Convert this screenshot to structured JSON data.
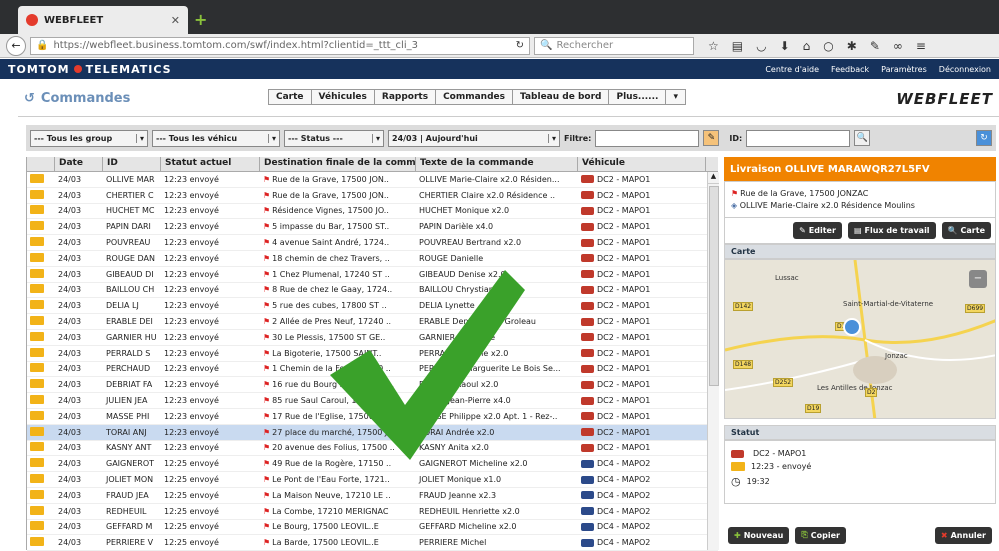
{
  "browser": {
    "tab_title": "WEBFLEET",
    "url": "https://webfleet.business.tomtom.com/swf/index.html?clientid=_ttt_cli_3",
    "search_placeholder": "Rechercher"
  },
  "brand": {
    "name": "TOMTOM",
    "suffix": "TELEMATICS",
    "links": [
      "Centre d'aide",
      "Feedback",
      "Paramètres",
      "Déconnexion"
    ]
  },
  "app": {
    "page_title": "Commandes",
    "menu": [
      "Carte",
      "Véhicules",
      "Rapports",
      "Commandes",
      "Tableau de bord",
      "Plus......"
    ],
    "logo": "WEBFLEET"
  },
  "filters": {
    "groups": "--- Tous les group",
    "vehicles": "--- Tous les véhicu",
    "status": "--- Status ---",
    "date": "24/03 | Aujourd'hui",
    "filter_label": "Filtre:",
    "id_label": "ID:"
  },
  "columns": [
    "Date",
    "ID",
    "Statut actuel",
    "Destination finale de la comm",
    "Texte de la commande",
    "Véhicule"
  ],
  "rows": [
    {
      "date": "24/03",
      "id": "OLLIVE MAR",
      "status": "12:23 envoyé",
      "dest": "Rue de la Grave, 17500 JON..",
      "text": "OLLIVE Marie-Claire x2.0 Résiden...",
      "veh": "DC2 - MAPO1",
      "truck": "red"
    },
    {
      "date": "24/03",
      "id": "CHERTIER C",
      "status": "12:23 envoyé",
      "dest": "Rue de la Grave, 17500 JON..",
      "text": "CHERTIER Claire x2.0 Résidence ..",
      "veh": "DC2 - MAPO1",
      "truck": "red"
    },
    {
      "date": "24/03",
      "id": "HUCHET MC",
      "status": "12:23 envoyé",
      "dest": "Résidence Vignes, 17500 JO..",
      "text": "HUCHET Monique x2.0",
      "veh": "DC2 - MAPO1",
      "truck": "red"
    },
    {
      "date": "24/03",
      "id": "PAPIN DARI",
      "status": "12:23 envoyé",
      "dest": "5 impasse du Bar, 17500 ST..",
      "text": "PAPIN Darièle x4.0",
      "veh": "DC2 - MAPO1",
      "truck": "red"
    },
    {
      "date": "24/03",
      "id": "POUVREAU",
      "status": "12:23 envoyé",
      "dest": "4 avenue Saint André, 1724..",
      "text": "POUVREAU Bertrand x2.0",
      "veh": "DC2 - MAPO1",
      "truck": "red"
    },
    {
      "date": "24/03",
      "id": "ROUGE DAN",
      "status": "12:23 envoyé",
      "dest": "18 chemin de chez Travers, ..",
      "text": "ROUGE Danielle",
      "veh": "DC2 - MAPO1",
      "truck": "red"
    },
    {
      "date": "24/03",
      "id": "GIBEAUD DI",
      "status": "12:23 envoyé",
      "dest": "1 Chez Plumenal, 17240 ST ..",
      "text": "GIBEAUD Denise x2.0",
      "veh": "DC2 - MAPO1",
      "truck": "red"
    },
    {
      "date": "24/03",
      "id": "BAILLOU CH",
      "status": "12:23 envoyé",
      "dest": "8 Rue de chez le Gaay, 1724..",
      "text": "BAILLOU Chrystiane x2.0",
      "veh": "DC2 - MAPO1",
      "truck": "red"
    },
    {
      "date": "24/03",
      "id": "DELIA  LJ",
      "status": "12:23 envoyé",
      "dest": "5 rue des cubes, 17800 ST ..",
      "text": "DELIA  Lynette",
      "veh": "DC2 - MAPO1",
      "truck": "red"
    },
    {
      "date": "24/03",
      "id": "ERABLE DEI",
      "status": "12:23 envoyé",
      "dest": "2 Allée de Pres Neuf, 17240 ..",
      "text": "ERABLE Denise Chez Groleau",
      "veh": "DC2 - MAPO1",
      "truck": "red"
    },
    {
      "date": "24/03",
      "id": "GARNIER HU",
      "status": "12:23 envoyé",
      "dest": "30 Le Plessis, 17500 ST GE..",
      "text": "GARNIER Huguette",
      "veh": "DC2 - MAPO1",
      "truck": "red"
    },
    {
      "date": "24/03",
      "id": "PERRALD  S",
      "status": "12:23 envoyé",
      "dest": "La Bigoterie, 17500 SAINT..",
      "text": "PERRALD Simone x2.0",
      "veh": "DC2 - MAPO1",
      "truck": "red"
    },
    {
      "date": "24/03",
      "id": "PERCHAUD",
      "status": "12:23 envoyé",
      "dest": "1 Chemin de la Font, 17500 ..",
      "text": "PERCHAUD Marguerite Le Bois Se...",
      "veh": "DC2 - MAPO1",
      "truck": "red"
    },
    {
      "date": "24/03",
      "id": "DEBRIAT FA",
      "status": "12:23 envoyé",
      "dest": "16 rue du Bourg Neuf, 17500..",
      "text": "DEBRIAT Raoul x2.0",
      "veh": "DC2 - MAPO1",
      "truck": "red"
    },
    {
      "date": "24/03",
      "id": "JULIEN JEA",
      "status": "12:23 envoyé",
      "dest": "85 rue Saul Caroul, 17500 J..",
      "text": "JULIEN Jean-Pierre x4.0",
      "veh": "DC2 - MAPO1",
      "truck": "red"
    },
    {
      "date": "24/03",
      "id": "MASSE PHI",
      "status": "12:23 envoyé",
      "dest": "17 Rue de l'Eglise, 17500 JO..",
      "text": "MASSE Philippe x2.0 Apt. 1 - Rez-..",
      "veh": "DC2 - MAPO1",
      "truck": "red"
    },
    {
      "date": "24/03",
      "id": "TORAI  ANJ",
      "status": "12:23 envoyé",
      "dest": "27 place du marché, 17500 J..",
      "text": "TORAI  Andrée x2.0",
      "veh": "DC2 - MAPO1",
      "truck": "red",
      "selected": true
    },
    {
      "date": "24/03",
      "id": "KASNY ANT",
      "status": "12:23 envoyé",
      "dest": "20 avenue des Folius, 17500 ..",
      "text": "KASNY Anita x2.0",
      "veh": "DC2 - MAPO1",
      "truck": "red"
    },
    {
      "date": "24/03",
      "id": "GAIGNEROT",
      "status": "12:25 envoyé",
      "dest": "49 Rue de la Rogère, 17150 ..",
      "text": "GAIGNEROT Micheline x2.0",
      "veh": "DC4 - MAPO2",
      "truck": "blue"
    },
    {
      "date": "24/03",
      "id": "JOLIET MON",
      "status": "12:25 envoyé",
      "dest": "Le Pont de l'Eau Forte, 1721..",
      "text": "JOLIET Monique x1.0",
      "veh": "DC4 - MAPO2",
      "truck": "blue"
    },
    {
      "date": "24/03",
      "id": "FRAUD  JEA",
      "status": "12:25 envoyé",
      "dest": "La Maison Neuve, 17210 LE ..",
      "text": "FRAUD Jeanne x2.3",
      "veh": "DC4 - MAPO2",
      "truck": "blue"
    },
    {
      "date": "24/03",
      "id": "REDHEUIL  ",
      "status": "12:25 envoyé",
      "dest": "La Combe, 17210 MERIGNAC",
      "text": "REDHEUIL Henriette x2.0",
      "veh": "DC4 - MAPO2",
      "truck": "blue"
    },
    {
      "date": "24/03",
      "id": "GEFFARD M",
      "status": "12:25 envoyé",
      "dest": "Le Bourg, 17500 LEOVIL..E",
      "text": "GEFFARD Micheline x2.0",
      "veh": "DC4 - MAPO2",
      "truck": "blue"
    },
    {
      "date": "24/03",
      "id": "PERRIERE V",
      "status": "12:25 envoyé",
      "dest": "La Barde, 17500 LEOVIL..E",
      "text": "PERRIERE Michel",
      "veh": "DC4 - MAPO2",
      "truck": "blue"
    }
  ],
  "detail": {
    "title": "Livraison OLLIVE MARAWQR27L5FV",
    "address": "Rue de la Grave, 17500 JONZAC",
    "name": "OLLIVE Marie-Claire x2.0 Résidence Moulins",
    "buttons": [
      "Editer",
      "Flux de travail",
      "Carte"
    ],
    "map_header": "Carte",
    "map_towns": [
      "Lussac",
      "Saint-Martial-de-Vitaterne",
      "Jonzac",
      "Les Antilles de Jonzac"
    ],
    "map_roads": [
      "D134",
      "D699",
      "D142",
      "D148",
      "D252",
      "D2",
      "D19"
    ],
    "status_header": "Statut",
    "vehicle": "DC2 - MAPO1",
    "status": "12:23 - envoyé",
    "time": "19:32",
    "bottom_buttons": [
      "Nouveau",
      "Copier",
      "Annuler"
    ]
  },
  "colors": {
    "accent": "#f08300",
    "navy": "#16325c",
    "selected": "#c9daf0",
    "check": "#3aa12a"
  }
}
